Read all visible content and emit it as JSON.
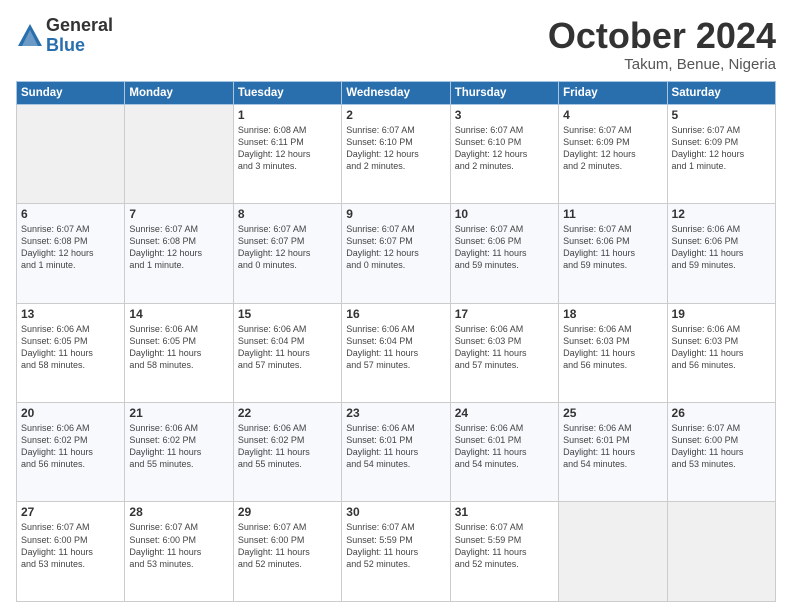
{
  "header": {
    "logo_general": "General",
    "logo_blue": "Blue",
    "month_title": "October 2024",
    "location": "Takum, Benue, Nigeria"
  },
  "calendar": {
    "days_of_week": [
      "Sunday",
      "Monday",
      "Tuesday",
      "Wednesday",
      "Thursday",
      "Friday",
      "Saturday"
    ],
    "weeks": [
      [
        {
          "day": "",
          "info": ""
        },
        {
          "day": "",
          "info": ""
        },
        {
          "day": "1",
          "info": "Sunrise: 6:08 AM\nSunset: 6:11 PM\nDaylight: 12 hours\nand 3 minutes."
        },
        {
          "day": "2",
          "info": "Sunrise: 6:07 AM\nSunset: 6:10 PM\nDaylight: 12 hours\nand 2 minutes."
        },
        {
          "day": "3",
          "info": "Sunrise: 6:07 AM\nSunset: 6:10 PM\nDaylight: 12 hours\nand 2 minutes."
        },
        {
          "day": "4",
          "info": "Sunrise: 6:07 AM\nSunset: 6:09 PM\nDaylight: 12 hours\nand 2 minutes."
        },
        {
          "day": "5",
          "info": "Sunrise: 6:07 AM\nSunset: 6:09 PM\nDaylight: 12 hours\nand 1 minute."
        }
      ],
      [
        {
          "day": "6",
          "info": "Sunrise: 6:07 AM\nSunset: 6:08 PM\nDaylight: 12 hours\nand 1 minute."
        },
        {
          "day": "7",
          "info": "Sunrise: 6:07 AM\nSunset: 6:08 PM\nDaylight: 12 hours\nand 1 minute."
        },
        {
          "day": "8",
          "info": "Sunrise: 6:07 AM\nSunset: 6:07 PM\nDaylight: 12 hours\nand 0 minutes."
        },
        {
          "day": "9",
          "info": "Sunrise: 6:07 AM\nSunset: 6:07 PM\nDaylight: 12 hours\nand 0 minutes."
        },
        {
          "day": "10",
          "info": "Sunrise: 6:07 AM\nSunset: 6:06 PM\nDaylight: 11 hours\nand 59 minutes."
        },
        {
          "day": "11",
          "info": "Sunrise: 6:07 AM\nSunset: 6:06 PM\nDaylight: 11 hours\nand 59 minutes."
        },
        {
          "day": "12",
          "info": "Sunrise: 6:06 AM\nSunset: 6:06 PM\nDaylight: 11 hours\nand 59 minutes."
        }
      ],
      [
        {
          "day": "13",
          "info": "Sunrise: 6:06 AM\nSunset: 6:05 PM\nDaylight: 11 hours\nand 58 minutes."
        },
        {
          "day": "14",
          "info": "Sunrise: 6:06 AM\nSunset: 6:05 PM\nDaylight: 11 hours\nand 58 minutes."
        },
        {
          "day": "15",
          "info": "Sunrise: 6:06 AM\nSunset: 6:04 PM\nDaylight: 11 hours\nand 57 minutes."
        },
        {
          "day": "16",
          "info": "Sunrise: 6:06 AM\nSunset: 6:04 PM\nDaylight: 11 hours\nand 57 minutes."
        },
        {
          "day": "17",
          "info": "Sunrise: 6:06 AM\nSunset: 6:03 PM\nDaylight: 11 hours\nand 57 minutes."
        },
        {
          "day": "18",
          "info": "Sunrise: 6:06 AM\nSunset: 6:03 PM\nDaylight: 11 hours\nand 56 minutes."
        },
        {
          "day": "19",
          "info": "Sunrise: 6:06 AM\nSunset: 6:03 PM\nDaylight: 11 hours\nand 56 minutes."
        }
      ],
      [
        {
          "day": "20",
          "info": "Sunrise: 6:06 AM\nSunset: 6:02 PM\nDaylight: 11 hours\nand 56 minutes."
        },
        {
          "day": "21",
          "info": "Sunrise: 6:06 AM\nSunset: 6:02 PM\nDaylight: 11 hours\nand 55 minutes."
        },
        {
          "day": "22",
          "info": "Sunrise: 6:06 AM\nSunset: 6:02 PM\nDaylight: 11 hours\nand 55 minutes."
        },
        {
          "day": "23",
          "info": "Sunrise: 6:06 AM\nSunset: 6:01 PM\nDaylight: 11 hours\nand 54 minutes."
        },
        {
          "day": "24",
          "info": "Sunrise: 6:06 AM\nSunset: 6:01 PM\nDaylight: 11 hours\nand 54 minutes."
        },
        {
          "day": "25",
          "info": "Sunrise: 6:06 AM\nSunset: 6:01 PM\nDaylight: 11 hours\nand 54 minutes."
        },
        {
          "day": "26",
          "info": "Sunrise: 6:07 AM\nSunset: 6:00 PM\nDaylight: 11 hours\nand 53 minutes."
        }
      ],
      [
        {
          "day": "27",
          "info": "Sunrise: 6:07 AM\nSunset: 6:00 PM\nDaylight: 11 hours\nand 53 minutes."
        },
        {
          "day": "28",
          "info": "Sunrise: 6:07 AM\nSunset: 6:00 PM\nDaylight: 11 hours\nand 53 minutes."
        },
        {
          "day": "29",
          "info": "Sunrise: 6:07 AM\nSunset: 6:00 PM\nDaylight: 11 hours\nand 52 minutes."
        },
        {
          "day": "30",
          "info": "Sunrise: 6:07 AM\nSunset: 5:59 PM\nDaylight: 11 hours\nand 52 minutes."
        },
        {
          "day": "31",
          "info": "Sunrise: 6:07 AM\nSunset: 5:59 PM\nDaylight: 11 hours\nand 52 minutes."
        },
        {
          "day": "",
          "info": ""
        },
        {
          "day": "",
          "info": ""
        }
      ]
    ]
  }
}
